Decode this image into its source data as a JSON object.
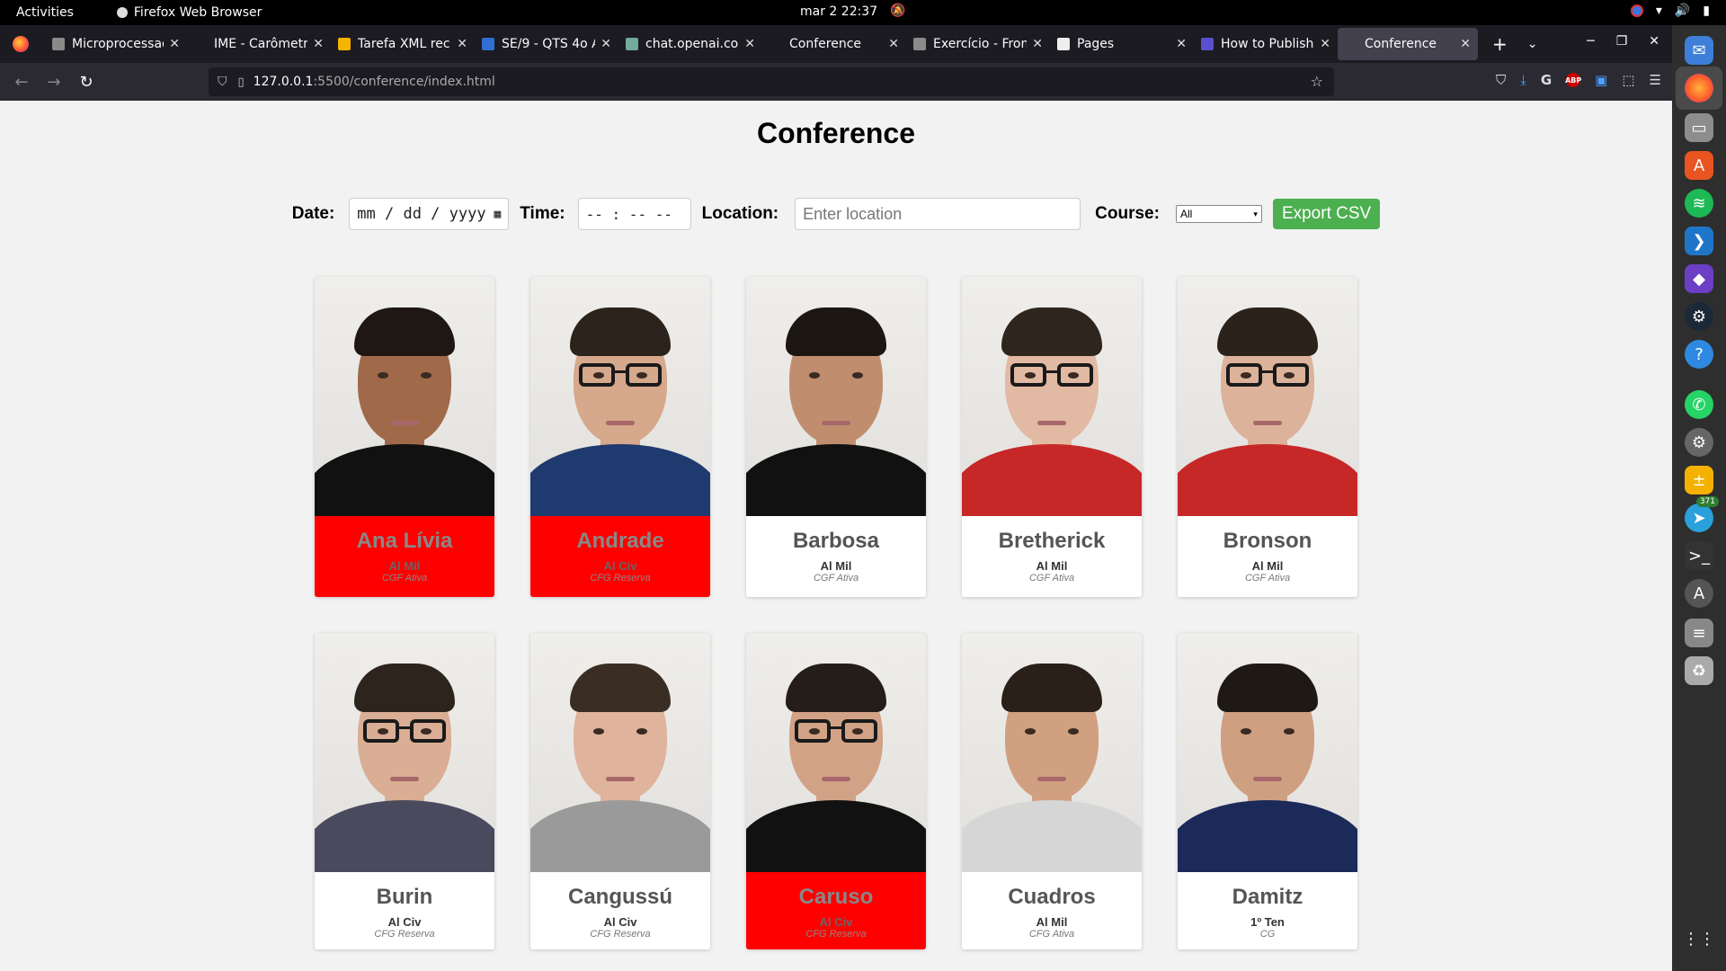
{
  "system": {
    "activities": "Activities",
    "app_name": "Firefox Web Browser",
    "clock": "mar 2  22:37"
  },
  "browser": {
    "tabs": [
      {
        "label": "Microprocessad",
        "favicon_color": "#8a8a8a",
        "active": false
      },
      {
        "label": "IME - Carômetro",
        "favicon_color": "#1c1b22",
        "active": false
      },
      {
        "label": "Tarefa XML rec",
        "favicon_color": "#f4b400",
        "active": false
      },
      {
        "label": "SE/9 - QTS 4o A",
        "favicon_color": "#2f6fd1",
        "active": false
      },
      {
        "label": "chat.openai.com",
        "favicon_color": "#74aa9c",
        "active": false
      },
      {
        "label": "Conference",
        "favicon_color": "#1c1b22",
        "active": false
      },
      {
        "label": "Exercício - Fron",
        "favicon_color": "#8a8a8a",
        "active": false
      },
      {
        "label": "Pages",
        "favicon_color": "#eeeeee",
        "active": false
      },
      {
        "label": "How to Publish",
        "favicon_color": "#5a4fcf",
        "active": false
      },
      {
        "label": "Conference",
        "favicon_color": "#42414d",
        "active": true
      }
    ],
    "url_host": "127.0.0.1",
    "url_path": ":5500/conference/index.html"
  },
  "page": {
    "title": "Conference",
    "filters": {
      "date_label": "Date:",
      "date_placeholder": "mm / dd / yyyy",
      "time_label": "Time:",
      "time_placeholder": "-- : --  --",
      "location_label": "Location:",
      "location_placeholder": "Enter location",
      "course_label": "Course:",
      "course_selected": "All",
      "export_label": "Export CSV"
    },
    "cards": [
      {
        "name": "Ana Lívia",
        "rank": "Al Mil",
        "course": "CGF Ativa",
        "highlight": true,
        "skin": "#a0694a",
        "hair": "#1e1713",
        "shirt": "#111111",
        "glasses": false
      },
      {
        "name": "Andrade",
        "rank": "Al Civ",
        "course": "CFG Reserva",
        "highlight": true,
        "skin": "#d6a88c",
        "hair": "#2b231c",
        "shirt": "#1f3a6e",
        "glasses": true
      },
      {
        "name": "Barbosa",
        "rank": "Al Mil",
        "course": "CGF Ativa",
        "highlight": false,
        "skin": "#c08e6e",
        "hair": "#1d1714",
        "shirt": "#111111",
        "glasses": false
      },
      {
        "name": "Bretherick",
        "rank": "Al Mil",
        "course": "CGF Ativa",
        "highlight": false,
        "skin": "#e2b9a2",
        "hair": "#2e251e",
        "shirt": "#c62828",
        "glasses": true
      },
      {
        "name": "Bronson",
        "rank": "Al Mil",
        "course": "CGF Ativa",
        "highlight": false,
        "skin": "#ddb29a",
        "hair": "#2a221b",
        "shirt": "#c62828",
        "glasses": true
      },
      {
        "name": "Burin",
        "rank": "Al Civ",
        "course": "CFG Reserva",
        "highlight": false,
        "skin": "#d9ae94",
        "hair": "#2c241d",
        "shirt": "#4a4a5e",
        "glasses": true
      },
      {
        "name": "Cangussú",
        "rank": "Al Civ",
        "course": "CFG Reserva",
        "highlight": false,
        "skin": "#e0b39c",
        "hair": "#3a2e24",
        "shirt": "#9a9a9a",
        "glasses": false
      },
      {
        "name": "Caruso",
        "rank": "Al Civ",
        "course": "CFG Reserva",
        "highlight": true,
        "skin": "#d2a286",
        "hair": "#251e18",
        "shirt": "#111111",
        "glasses": true
      },
      {
        "name": "Cuadros",
        "rank": "Al Mil",
        "course": "CFG Ativa",
        "highlight": false,
        "skin": "#d0a080",
        "hair": "#2a2019",
        "shirt": "#d6d6d6",
        "glasses": false
      },
      {
        "name": "Damitz",
        "rank": "1º Ten",
        "course": "CG",
        "highlight": false,
        "skin": "#cf9f82",
        "hair": "#1f1915",
        "shirt": "#1c2a5a",
        "glasses": false
      }
    ]
  },
  "colors": {
    "highlight": "#ff0000",
    "export_button": "#4caf50",
    "page_background": "#f2f2f2"
  }
}
